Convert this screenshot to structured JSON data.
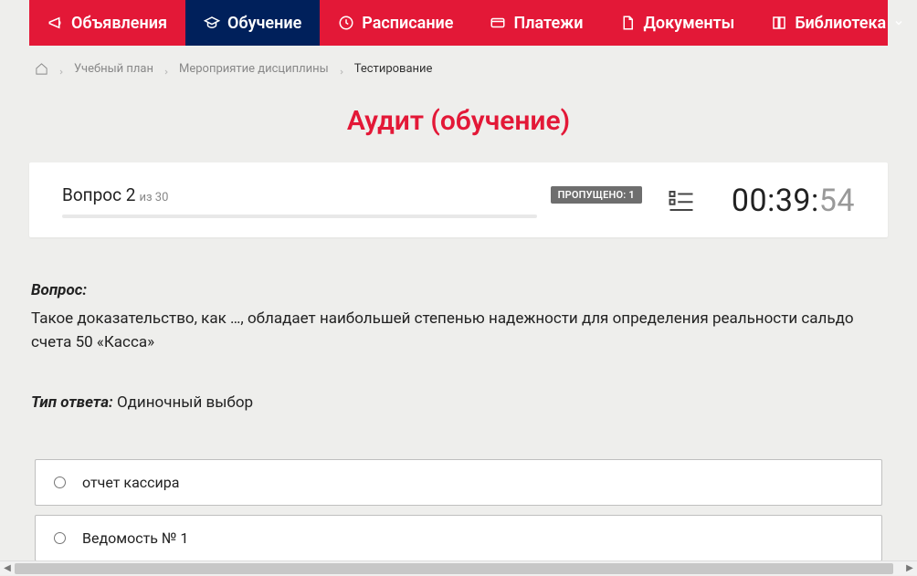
{
  "nav": {
    "items": [
      {
        "label": "Объявления",
        "icon": "megaphone-icon",
        "active": false
      },
      {
        "label": "Обучение",
        "icon": "graduation-icon",
        "active": true
      },
      {
        "label": "Расписание",
        "icon": "clock-icon",
        "active": false
      },
      {
        "label": "Платежи",
        "icon": "payment-icon",
        "active": false
      },
      {
        "label": "Документы",
        "icon": "document-icon",
        "active": false
      },
      {
        "label": "Библиотека",
        "icon": "book-icon",
        "active": false,
        "dropdown": true
      }
    ]
  },
  "breadcrumb": {
    "items": [
      {
        "label": "Учебный план",
        "current": false
      },
      {
        "label": "Мероприятие дисциплины",
        "current": false
      },
      {
        "label": "Тестирование",
        "current": true
      }
    ]
  },
  "page_title": "Аудит (обучение)",
  "panel": {
    "question_label": "Вопрос 2",
    "total_label": "из 30",
    "skipped_badge": "ПРОПУЩЕНО: 1",
    "timer_main": "00:39:",
    "timer_sec": "54"
  },
  "question": {
    "heading": "Вопрос:",
    "text": "Такое доказательство, как …, обладает наибольшей степенью надежности для определения реальности сальдо счета 50 «Касса»",
    "answer_type_label": "Тип ответа:",
    "answer_type_value": "Одиночный выбор"
  },
  "options": [
    {
      "label": "отчет кассира"
    },
    {
      "label": "Ведомость № 1"
    }
  ]
}
